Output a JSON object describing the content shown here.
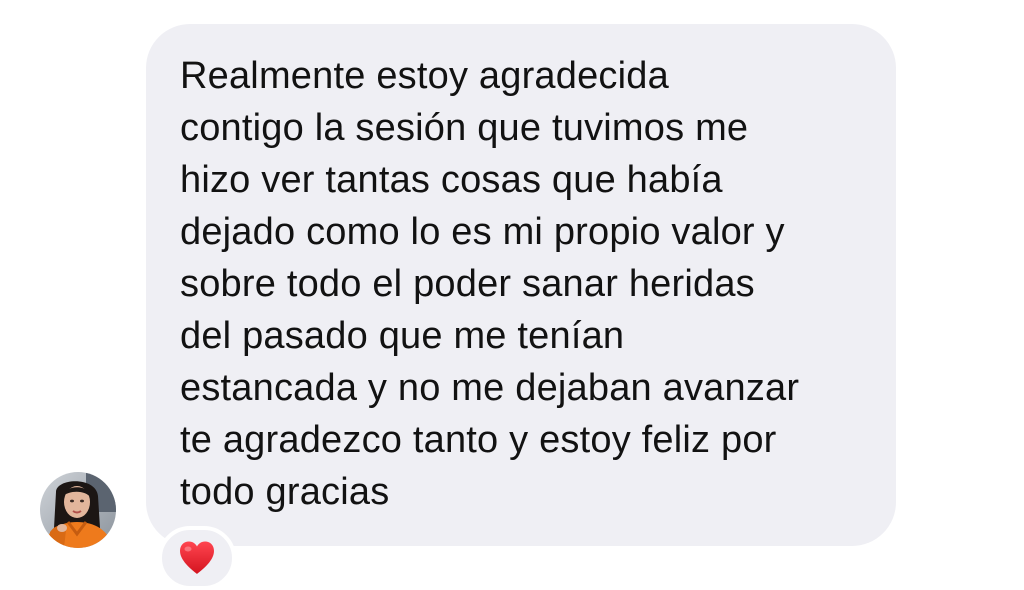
{
  "conversation": {
    "message": {
      "lines": [
        "Realmente estoy agradecida",
        "contigo la sesión que tuvimos me",
        "hizo ver tantas cosas que había",
        "dejado como lo es mi propio valor y",
        "sobre todo el poder sanar heridas",
        "del pasado que me tenían",
        "estancada y no me dejaban avanzar",
        "te agradezco tanto y estoy feliz por",
        "todo gracias"
      ],
      "bubble_color": "#efeff4",
      "text_color": "#121212"
    },
    "sender": {
      "avatar_icon": "profile-photo-avatar"
    },
    "reaction": {
      "icon": "red-heart-icon",
      "color": "#e8202c"
    }
  }
}
